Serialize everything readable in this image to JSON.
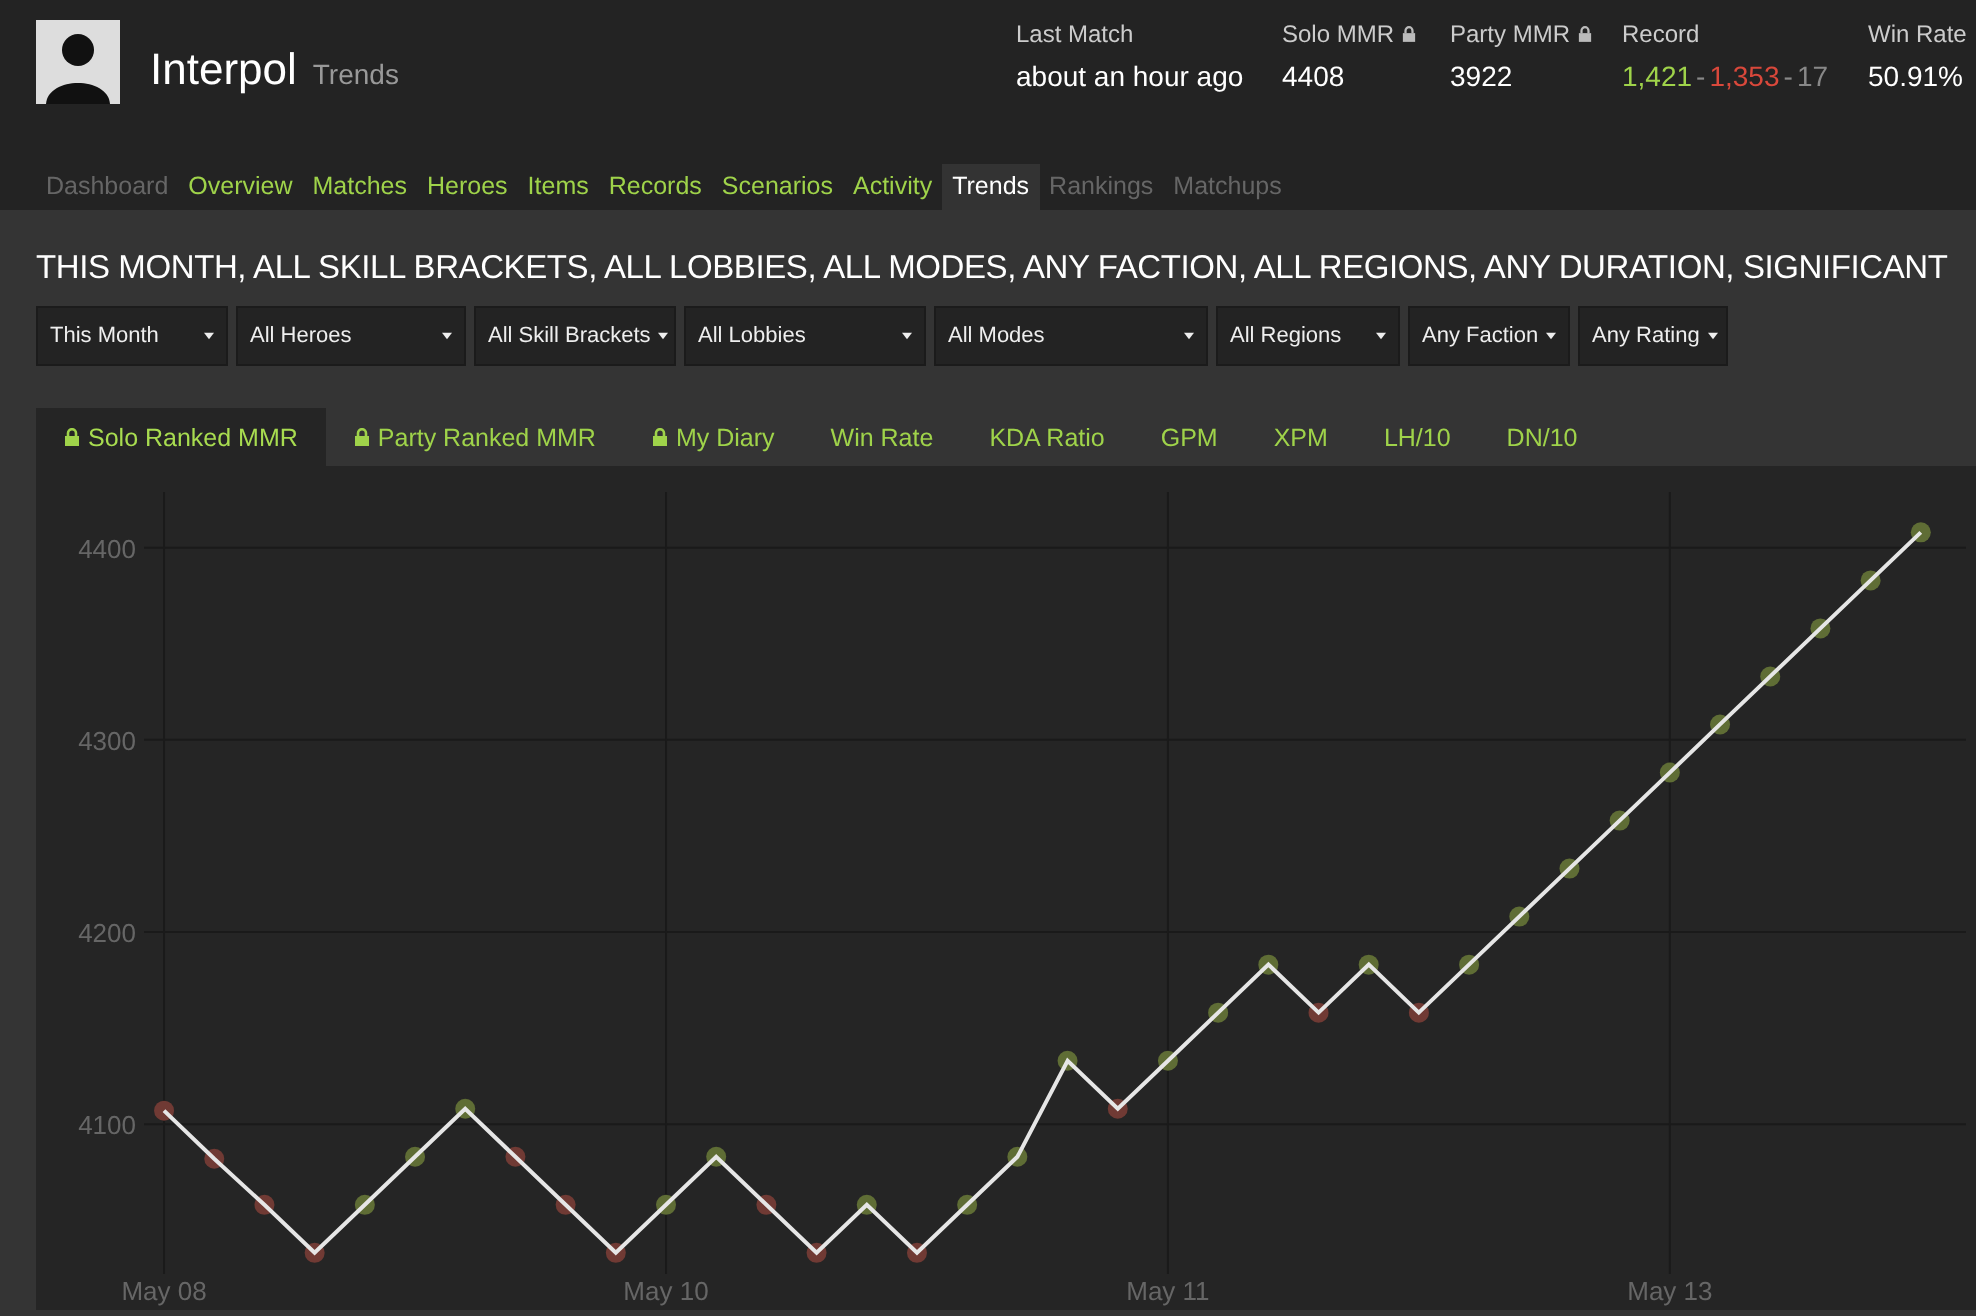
{
  "header": {
    "name": "Interpol",
    "subtitle": "Trends",
    "stats": [
      {
        "label": "Last Match",
        "locked": false,
        "value": "about an hour ago"
      },
      {
        "label": "Solo MMR",
        "locked": true,
        "value": "4408"
      },
      {
        "label": "Party MMR",
        "locked": true,
        "value": "3922"
      },
      {
        "label": "Record",
        "locked": false,
        "parts": [
          {
            "kind": "win",
            "text": "1,421"
          },
          {
            "kind": "sep",
            "text": "-"
          },
          {
            "kind": "loss",
            "text": "1,353"
          },
          {
            "kind": "sep",
            "text": "-"
          },
          {
            "kind": "abandon",
            "text": "17"
          }
        ]
      },
      {
        "label": "Win Rate",
        "locked": false,
        "value": "50.91%"
      }
    ]
  },
  "nav": [
    {
      "label": "Dashboard",
      "selected": false,
      "disabled": true
    },
    {
      "label": "Overview",
      "selected": false,
      "disabled": false
    },
    {
      "label": "Matches",
      "selected": false,
      "disabled": false
    },
    {
      "label": "Heroes",
      "selected": false,
      "disabled": false
    },
    {
      "label": "Items",
      "selected": false,
      "disabled": false
    },
    {
      "label": "Records",
      "selected": false,
      "disabled": false
    },
    {
      "label": "Scenarios",
      "selected": false,
      "disabled": false
    },
    {
      "label": "Activity",
      "selected": false,
      "disabled": false
    },
    {
      "label": "Trends",
      "selected": true,
      "disabled": false
    },
    {
      "label": "Rankings",
      "selected": false,
      "disabled": true
    },
    {
      "label": "Matchups",
      "selected": false,
      "disabled": true
    }
  ],
  "heading": "THIS MONTH, ALL SKILL BRACKETS, ALL LOBBIES, ALL MODES, ANY FACTION, ALL REGIONS, ANY DURATION, SIGNIFICANT",
  "filters": [
    "This Month",
    "All Heroes",
    "All Skill Brackets",
    "All Lobbies",
    "All Modes",
    "All Regions",
    "Any Faction",
    "Any Rating"
  ],
  "chart_tabs": [
    {
      "label": "Solo Ranked MMR",
      "selected": true,
      "locked": true
    },
    {
      "label": "Party Ranked MMR",
      "selected": false,
      "locked": true
    },
    {
      "label": "My Diary",
      "selected": false,
      "locked": true
    },
    {
      "label": "Win Rate",
      "selected": false,
      "locked": false
    },
    {
      "label": "KDA Ratio",
      "selected": false,
      "locked": false
    },
    {
      "label": "GPM",
      "selected": false,
      "locked": false
    },
    {
      "label": "XPM",
      "selected": false,
      "locked": false
    },
    {
      "label": "LH/10",
      "selected": false,
      "locked": false
    },
    {
      "label": "DN/10",
      "selected": false,
      "locked": false
    }
  ],
  "chart": {
    "chart_data": {
      "type": "line",
      "categories": [
        "May 08",
        null,
        null,
        null,
        null,
        null,
        null,
        null,
        null,
        null,
        "May 10",
        null,
        null,
        null,
        null,
        null,
        null,
        null,
        null,
        null,
        "May 11",
        null,
        null,
        null,
        null,
        null,
        null,
        null,
        null,
        null,
        "May 13",
        null,
        null,
        null,
        null,
        null
      ],
      "ylim": [
        4022,
        4429
      ],
      "grid": true,
      "yticks": [
        4100,
        4200,
        4300,
        4400
      ],
      "series": [
        {
          "color": "#e6e6e6",
          "marker": "circle",
          "values": [
            4107,
            4082,
            4058,
            4033,
            4058,
            4083,
            4108,
            4083,
            4058,
            4033,
            4058,
            4083,
            4058,
            4033,
            4058,
            4033,
            4058,
            4083,
            4133,
            4108,
            4133,
            4158,
            4183,
            4158,
            4183,
            4158,
            4183,
            4208,
            4233,
            4258,
            4283,
            4308,
            4333,
            4358,
            4383,
            4408
          ]
        }
      ]
    },
    "points": [
      {
        "kind": "loss"
      },
      {
        "kind": "loss"
      },
      {
        "kind": "loss"
      },
      {
        "kind": "loss"
      },
      {
        "kind": "win"
      },
      {
        "kind": "win"
      },
      {
        "kind": "win"
      },
      {
        "kind": "loss"
      },
      {
        "kind": "loss"
      },
      {
        "kind": "loss"
      },
      {
        "kind": "win"
      },
      {
        "kind": "win"
      },
      {
        "kind": "loss"
      },
      {
        "kind": "loss"
      },
      {
        "kind": "win"
      },
      {
        "kind": "loss"
      },
      {
        "kind": "win"
      },
      {
        "kind": "win"
      },
      {
        "kind": "win"
      },
      {
        "kind": "loss"
      },
      {
        "kind": "win"
      },
      {
        "kind": "win"
      },
      {
        "kind": "win"
      },
      {
        "kind": "loss"
      },
      {
        "kind": "win"
      },
      {
        "kind": "loss"
      },
      {
        "kind": "win"
      },
      {
        "kind": "win"
      },
      {
        "kind": "win"
      },
      {
        "kind": "win"
      },
      {
        "kind": "win"
      },
      {
        "kind": "win"
      },
      {
        "kind": "win"
      },
      {
        "kind": "win"
      },
      {
        "kind": "win"
      },
      {
        "kind": "win"
      }
    ]
  }
}
